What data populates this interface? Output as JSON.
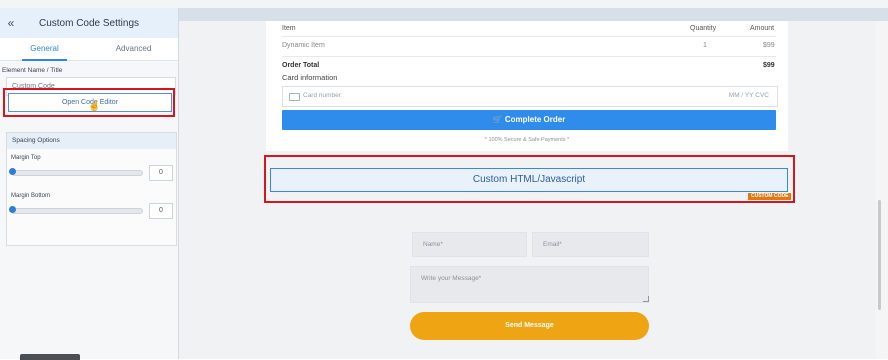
{
  "panel": {
    "back_icon": "«",
    "title": "Custom Code Settings",
    "tabs": [
      {
        "label": "General",
        "active": true
      },
      {
        "label": "Advanced",
        "active": false
      }
    ],
    "element_name_label": "Element Name / Title",
    "element_name_value": "Custom Code",
    "editor_button": "Open Code Editor",
    "spacing": {
      "heading": "Spacing Options",
      "margin_top_label": "Margin Top",
      "margin_top_value": "0",
      "margin_bottom_label": "Margin Bottom",
      "margin_bottom_value": "0"
    }
  },
  "order": {
    "col_item": "Item",
    "col_quantity": "Quantity",
    "col_amount": "Amount",
    "row_item": "Dynamic Item",
    "row_qty": "1",
    "row_amount": "$99",
    "total_label": "Order Total",
    "total_value": "$99",
    "card_info_label": "Card information",
    "card_number_placeholder": "Card number",
    "card_mm_cvc": "MM / YY  CVC",
    "complete_button": "Complete Order",
    "secure_note": "* 100% Secure & Safe Payments *"
  },
  "custom_element": {
    "label": "Custom HTML/Javascript",
    "badge": "CUSTOM CODE"
  },
  "form": {
    "name_placeholder": "Name*",
    "email_placeholder": "Email*",
    "message_placeholder": "Write your Message*",
    "send_button": "Send Message"
  },
  "colors": {
    "accent_blue": "#2f8ceb",
    "send_orange": "#efa413",
    "highlight_red": "#d8141e",
    "badge_orange": "#e07a10"
  }
}
